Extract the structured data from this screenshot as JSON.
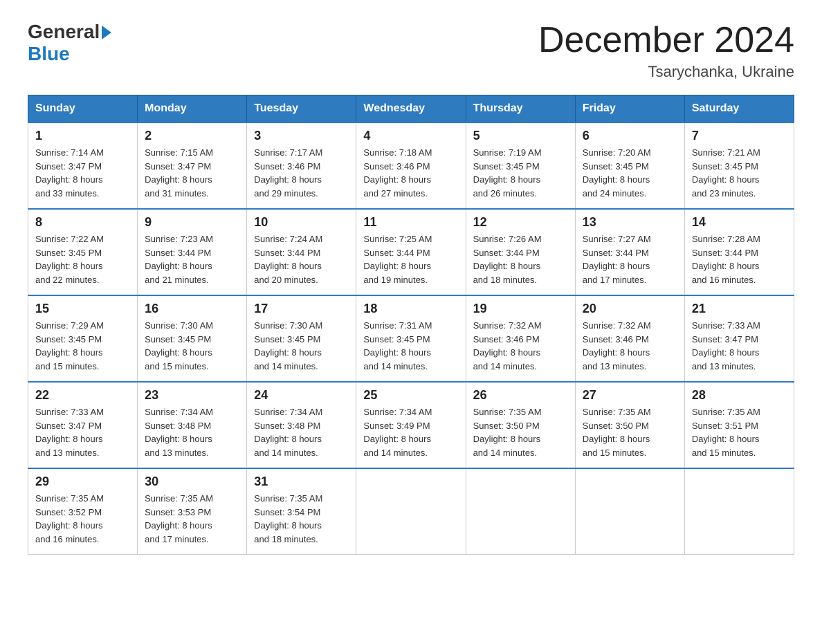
{
  "logo": {
    "general": "General",
    "blue": "Blue"
  },
  "title": "December 2024",
  "location": "Tsarychanka, Ukraine",
  "days_of_week": [
    "Sunday",
    "Monday",
    "Tuesday",
    "Wednesday",
    "Thursday",
    "Friday",
    "Saturday"
  ],
  "weeks": [
    [
      {
        "day": "1",
        "sunrise": "7:14 AM",
        "sunset": "3:47 PM",
        "daylight": "8 hours and 33 minutes."
      },
      {
        "day": "2",
        "sunrise": "7:15 AM",
        "sunset": "3:47 PM",
        "daylight": "8 hours and 31 minutes."
      },
      {
        "day": "3",
        "sunrise": "7:17 AM",
        "sunset": "3:46 PM",
        "daylight": "8 hours and 29 minutes."
      },
      {
        "day": "4",
        "sunrise": "7:18 AM",
        "sunset": "3:46 PM",
        "daylight": "8 hours and 27 minutes."
      },
      {
        "day": "5",
        "sunrise": "7:19 AM",
        "sunset": "3:45 PM",
        "daylight": "8 hours and 26 minutes."
      },
      {
        "day": "6",
        "sunrise": "7:20 AM",
        "sunset": "3:45 PM",
        "daylight": "8 hours and 24 minutes."
      },
      {
        "day": "7",
        "sunrise": "7:21 AM",
        "sunset": "3:45 PM",
        "daylight": "8 hours and 23 minutes."
      }
    ],
    [
      {
        "day": "8",
        "sunrise": "7:22 AM",
        "sunset": "3:45 PM",
        "daylight": "8 hours and 22 minutes."
      },
      {
        "day": "9",
        "sunrise": "7:23 AM",
        "sunset": "3:44 PM",
        "daylight": "8 hours and 21 minutes."
      },
      {
        "day": "10",
        "sunrise": "7:24 AM",
        "sunset": "3:44 PM",
        "daylight": "8 hours and 20 minutes."
      },
      {
        "day": "11",
        "sunrise": "7:25 AM",
        "sunset": "3:44 PM",
        "daylight": "8 hours and 19 minutes."
      },
      {
        "day": "12",
        "sunrise": "7:26 AM",
        "sunset": "3:44 PM",
        "daylight": "8 hours and 18 minutes."
      },
      {
        "day": "13",
        "sunrise": "7:27 AM",
        "sunset": "3:44 PM",
        "daylight": "8 hours and 17 minutes."
      },
      {
        "day": "14",
        "sunrise": "7:28 AM",
        "sunset": "3:44 PM",
        "daylight": "8 hours and 16 minutes."
      }
    ],
    [
      {
        "day": "15",
        "sunrise": "7:29 AM",
        "sunset": "3:45 PM",
        "daylight": "8 hours and 15 minutes."
      },
      {
        "day": "16",
        "sunrise": "7:30 AM",
        "sunset": "3:45 PM",
        "daylight": "8 hours and 15 minutes."
      },
      {
        "day": "17",
        "sunrise": "7:30 AM",
        "sunset": "3:45 PM",
        "daylight": "8 hours and 14 minutes."
      },
      {
        "day": "18",
        "sunrise": "7:31 AM",
        "sunset": "3:45 PM",
        "daylight": "8 hours and 14 minutes."
      },
      {
        "day": "19",
        "sunrise": "7:32 AM",
        "sunset": "3:46 PM",
        "daylight": "8 hours and 14 minutes."
      },
      {
        "day": "20",
        "sunrise": "7:32 AM",
        "sunset": "3:46 PM",
        "daylight": "8 hours and 13 minutes."
      },
      {
        "day": "21",
        "sunrise": "7:33 AM",
        "sunset": "3:47 PM",
        "daylight": "8 hours and 13 minutes."
      }
    ],
    [
      {
        "day": "22",
        "sunrise": "7:33 AM",
        "sunset": "3:47 PM",
        "daylight": "8 hours and 13 minutes."
      },
      {
        "day": "23",
        "sunrise": "7:34 AM",
        "sunset": "3:48 PM",
        "daylight": "8 hours and 13 minutes."
      },
      {
        "day": "24",
        "sunrise": "7:34 AM",
        "sunset": "3:48 PM",
        "daylight": "8 hours and 14 minutes."
      },
      {
        "day": "25",
        "sunrise": "7:34 AM",
        "sunset": "3:49 PM",
        "daylight": "8 hours and 14 minutes."
      },
      {
        "day": "26",
        "sunrise": "7:35 AM",
        "sunset": "3:50 PM",
        "daylight": "8 hours and 14 minutes."
      },
      {
        "day": "27",
        "sunrise": "7:35 AM",
        "sunset": "3:50 PM",
        "daylight": "8 hours and 15 minutes."
      },
      {
        "day": "28",
        "sunrise": "7:35 AM",
        "sunset": "3:51 PM",
        "daylight": "8 hours and 15 minutes."
      }
    ],
    [
      {
        "day": "29",
        "sunrise": "7:35 AM",
        "sunset": "3:52 PM",
        "daylight": "8 hours and 16 minutes."
      },
      {
        "day": "30",
        "sunrise": "7:35 AM",
        "sunset": "3:53 PM",
        "daylight": "8 hours and 17 minutes."
      },
      {
        "day": "31",
        "sunrise": "7:35 AM",
        "sunset": "3:54 PM",
        "daylight": "8 hours and 18 minutes."
      },
      null,
      null,
      null,
      null
    ]
  ],
  "labels": {
    "sunrise": "Sunrise:",
    "sunset": "Sunset:",
    "daylight": "Daylight:"
  }
}
